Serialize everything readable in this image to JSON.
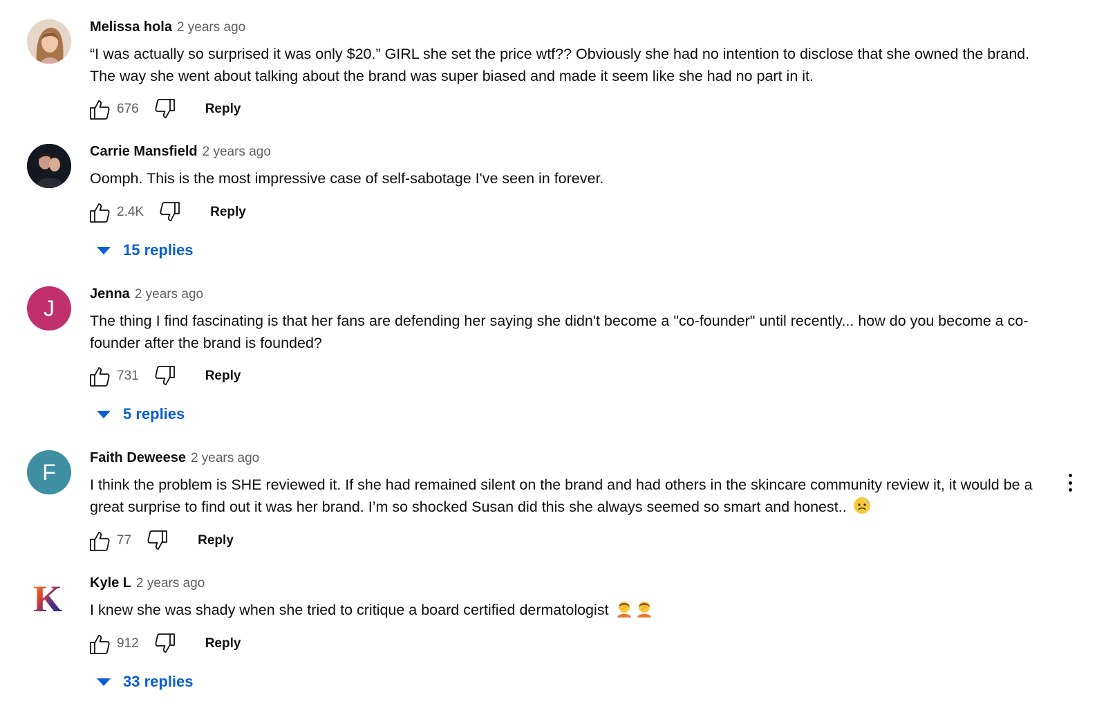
{
  "colors": {
    "link_blue": "#065fd4",
    "avatar_jenna": "#c0306c",
    "avatar_faith": "#3d8fa1"
  },
  "comments": [
    {
      "author": "Melissa hola",
      "time": "2 years ago",
      "text": "“I was actually so surprised it was only $20.” GIRL she set the price wtf?? Obviously she had no intention to disclose that she owned the brand. The way she went about talking about the brand was super biased and made it seem like she had no part in it.",
      "likes": "676",
      "reply_label": "Reply"
    },
    {
      "author": "Carrie Mansfield",
      "time": "2 years ago",
      "text": "Oomph. This is the most impressive case of self-sabotage I've seen in forever.",
      "likes": "2.4K",
      "reply_label": "Reply",
      "replies_label": "15 replies"
    },
    {
      "author": "Jenna",
      "time": "2 years ago",
      "avatar_letter": "J",
      "text": "The thing I find fascinating is that her fans are defending her saying she didn't become a \"co-founder\" until recently... how do you become a co-founder after the brand is founded?",
      "likes": "731",
      "reply_label": "Reply",
      "replies_label": "5 replies"
    },
    {
      "author": "Faith Deweese",
      "time": "2 years ago",
      "avatar_letter": "F",
      "text": "I think the problem is SHE reviewed it. If she had remained silent on the brand and had others in the skincare community review it, it would be a great surprise to find out it was her brand. I’m so shocked Susan did this she always seemed so smart and honest..",
      "likes": "77",
      "reply_label": "Reply"
    },
    {
      "author": "Kyle L",
      "time": "2 years ago",
      "avatar_letter": "K",
      "text": "I knew she was shady when she tried to critique a board certified dermatologist",
      "likes": "912",
      "reply_label": "Reply",
      "replies_label": "33 replies"
    }
  ]
}
